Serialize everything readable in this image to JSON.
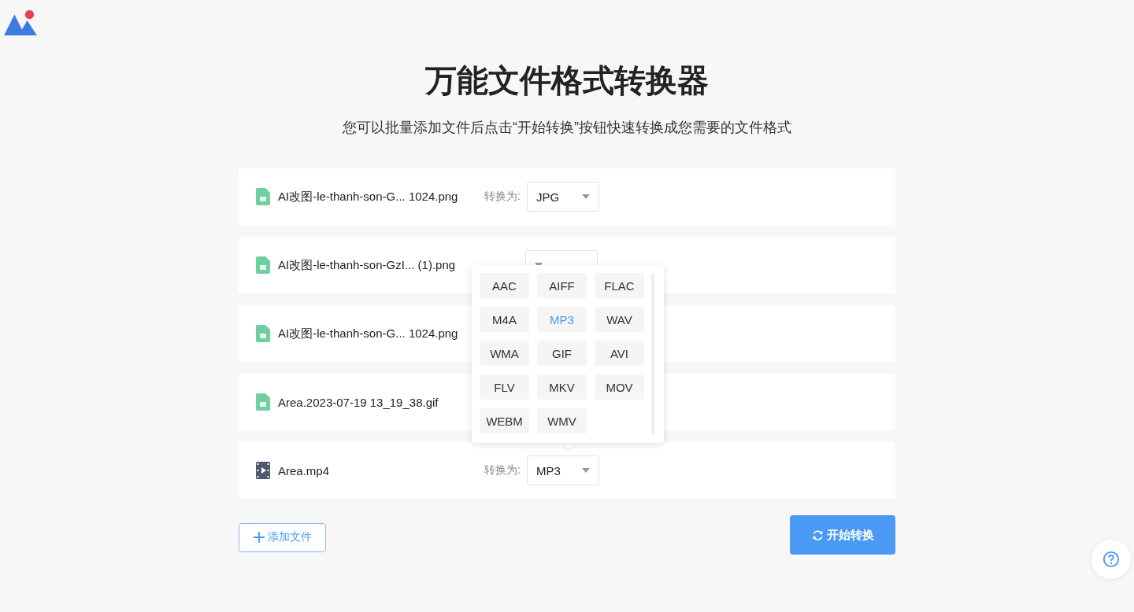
{
  "title": "万能文件格式转换器",
  "subtitle": "您可以批量添加文件后点击“开始转换”按钮快速转换成您需要的文件格式",
  "files": [
    {
      "name": "AI改图-le-thanh-son-G... 1024.png",
      "kind": "image",
      "label": "转换为:",
      "format": "JPG"
    },
    {
      "name": "AI改图-le-thanh-son-GzI...  (1).png",
      "kind": "image"
    },
    {
      "name": "AI改图-le-thanh-son-G... 1024.png",
      "kind": "image"
    },
    {
      "name": "Area.2023-07-19 13_19_38.gif",
      "kind": "image"
    },
    {
      "name": "Area.mp4",
      "kind": "video",
      "label": "转换为:",
      "format": "MP3"
    }
  ],
  "format_menu": {
    "options": [
      {
        "label": "AAC",
        "selected": false
      },
      {
        "label": "AIFF",
        "selected": false
      },
      {
        "label": "FLAC",
        "selected": false
      },
      {
        "label": "M4A",
        "selected": false
      },
      {
        "label": "MP3",
        "selected": true
      },
      {
        "label": "WAV",
        "selected": false
      },
      {
        "label": "WMA",
        "selected": false
      },
      {
        "label": "GIF",
        "selected": false
      },
      {
        "label": "AVI",
        "selected": false
      },
      {
        "label": "FLV",
        "selected": false
      },
      {
        "label": "MKV",
        "selected": false
      },
      {
        "label": "MOV",
        "selected": false
      },
      {
        "label": "WEBM",
        "selected": false
      },
      {
        "label": "WMV",
        "selected": false
      }
    ]
  },
  "add_button": "添加文件",
  "start_button": "开始转换"
}
